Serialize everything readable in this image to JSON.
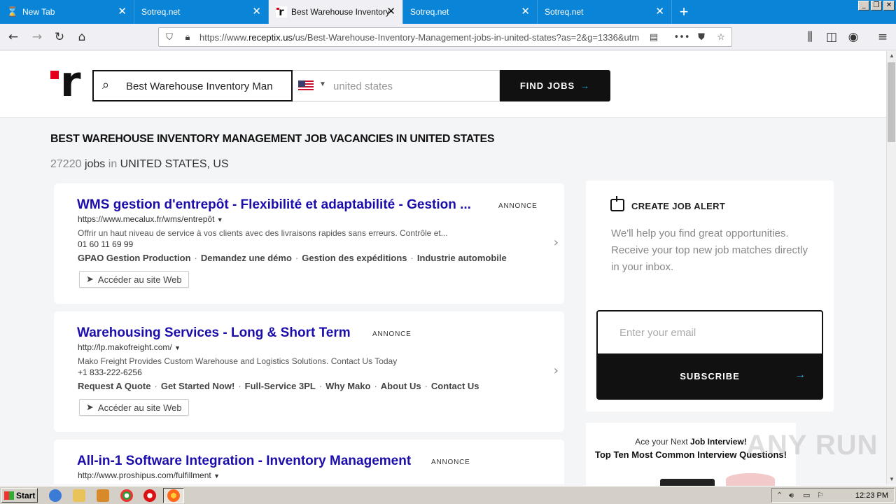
{
  "browser": {
    "tabs": [
      {
        "title": "New Tab",
        "favicon": "hourglass-icon",
        "active": false
      },
      {
        "title": "Sotreq.net",
        "favicon": "none",
        "active": false
      },
      {
        "title": "Best Warehouse Inventory",
        "favicon": "receptix-icon",
        "active": true
      },
      {
        "title": "Sotreq.net",
        "favicon": "none",
        "active": false
      },
      {
        "title": "Sotreq.net",
        "favicon": "none",
        "active": false
      }
    ],
    "url_prefix": "https://www.",
    "url_domain": "receptix.us",
    "url_path": "/us/Best-Warehouse-Inventory-Management-jobs-in-united-states?as=2&g=1336&utm"
  },
  "header": {
    "search_value": "Best Warehouse Inventory Man",
    "location_placeholder": "united states",
    "find_label": "FIND JOBS",
    "arrow": "→"
  },
  "main": {
    "title": "BEST WAREHOUSE INVENTORY MANAGEMENT JOB VACANCIES IN UNITED STATES",
    "count_number": "27220",
    "count_jobs": "jobs",
    "count_in": "in",
    "count_location": "UNITED STATES, US",
    "ads": [
      {
        "title": "WMS gestion d'entrepôt - Flexibilité et adaptabilité - Gestion ...",
        "badge": "ANNONCE",
        "url": "https://www.mecalux.fr/wms/entrepôt",
        "desc": "Offrir un haut niveau de service à vos clients avec des livraisons rapides sans erreurs. Contrôle et...",
        "phone": "01 60 11 69 99",
        "links": [
          "GPAO Gestion Production",
          "Demandez une démo",
          "Gestion des expéditions",
          "Industrie automobile"
        ],
        "button": "Accéder au site Web"
      },
      {
        "title": "Warehousing Services - Long & Short Term",
        "badge": "ANNONCE",
        "url": "http://lp.makofreight.com/",
        "desc": "Mako Freight Provides Custom Warehouse and Logistics Solutions. Contact Us Today",
        "phone": "+1 833-222-6256",
        "links": [
          "Request A Quote",
          "Get Started Now!",
          "Full-Service 3PL",
          "Why Mako",
          "About Us",
          "Contact Us"
        ],
        "button": "Accéder au site Web"
      },
      {
        "title": "All-in-1 Software Integration - Inventory Management",
        "badge": "ANNONCE",
        "url": "http://www.proshipus.com/fulfillment"
      }
    ]
  },
  "sidebar": {
    "alert_title": "CREATE JOB ALERT",
    "alert_text": "We'll help you find great opportunities. Receive your top new job matches directly in your inbox.",
    "email_placeholder": "Enter your email",
    "subscribe_label": "SUBSCRIBE",
    "promo_prefix": "Ace your Next",
    "promo_strong": "Job Interview!",
    "promo_title": "Top Ten Most Common Interview Questions!"
  },
  "watermark": "ANY RUN",
  "taskbar": {
    "start_label": "Start",
    "clock": "12:23 PM"
  },
  "colors": {
    "tab_bar": "#0a84d6",
    "brand_red": "#e4001b",
    "ad_title": "#1a0dab",
    "accent_arrow": "#2ab0e4"
  }
}
